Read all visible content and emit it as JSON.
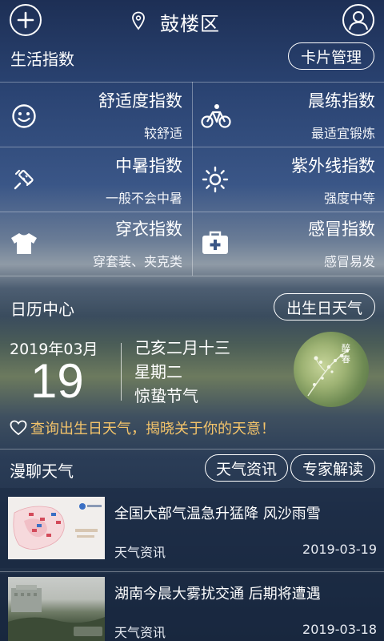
{
  "header": {
    "add_icon": "plus-icon",
    "location_icon": "location-pin-icon",
    "title": "鼓楼区",
    "profile_icon": "user-icon"
  },
  "life_index": {
    "section_title": "生活指数",
    "manage_button": "卡片管理",
    "items": [
      {
        "icon": "smiley-icon",
        "name": "舒适度指数",
        "value": "较舒适"
      },
      {
        "icon": "bicycle-icon",
        "name": "晨练指数",
        "value": "最适宜锻炼"
      },
      {
        "icon": "thermometer-icon",
        "name": "中暑指数",
        "value": "一般不会中暑"
      },
      {
        "icon": "sun-icon",
        "name": "紫外线指数",
        "value": "强度中等"
      },
      {
        "icon": "tshirt-icon",
        "name": "穿衣指数",
        "value": "穿套装、夹克类"
      },
      {
        "icon": "medical-kit-icon",
        "name": "感冒指数",
        "value": "感冒易发"
      }
    ]
  },
  "calendar": {
    "section_title": "日历中心",
    "birthday_button": "出生日天气",
    "year_month": "2019年03月",
    "day": "19",
    "lunar_date": "己亥二月十三",
    "weekday": "星期二",
    "solar_term": "惊蛰节气",
    "badge_text_1": "醉",
    "badge_text_2": "春",
    "birthday_link": "查询出生日天气，揭晓关于你的天意！"
  },
  "chat": {
    "section_title": "漫聊天气",
    "tab_news": "天气资讯",
    "tab_expert": "专家解读",
    "articles": [
      {
        "title": "全国大部气温急升猛降 风沙雨雪",
        "category": "天气资讯",
        "date": "2019-03-19"
      },
      {
        "title": "湖南今晨大雾扰交通 后期将遭遇",
        "category": "天气资讯",
        "date": "2019-03-18"
      }
    ]
  },
  "colors": {
    "link_gold": "#f3c36a",
    "line": "rgba(255,255,255,0.35)"
  }
}
